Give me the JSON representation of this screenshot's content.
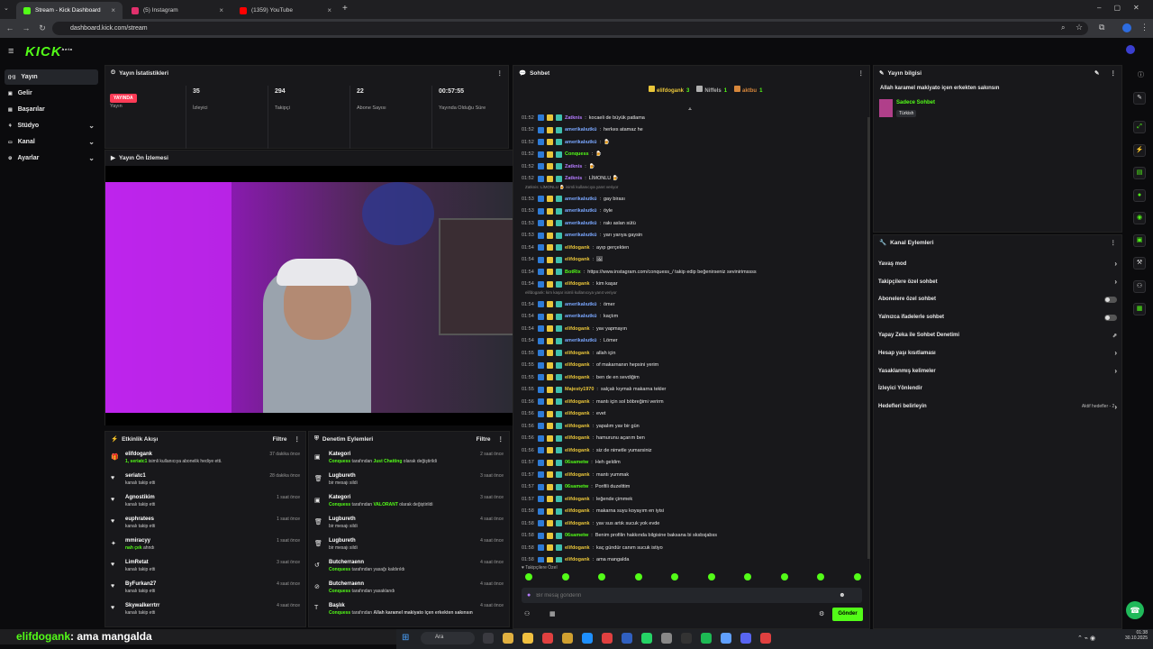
{
  "browser": {
    "tabs": [
      {
        "title": "Stream - Kick Dashboard",
        "active": true,
        "color": "#53fc18"
      },
      {
        "title": "(5) Instagram",
        "active": false,
        "color": "#e1306c"
      },
      {
        "title": "(1359) YouTube",
        "active": false,
        "color": "#ff0000"
      }
    ],
    "url": "dashboard.kick.com/stream",
    "close_glyph": "×",
    "new_tab_glyph": "+"
  },
  "app": {
    "logo": "KICK",
    "logo_suffix": "beta",
    "menu_icon": "hamburger-icon"
  },
  "sidebar": {
    "items": [
      {
        "label": "Yayın",
        "active": true,
        "chevron": false
      },
      {
        "label": "Gelir",
        "active": false,
        "chevron": false
      },
      {
        "label": "Başarılar",
        "active": false,
        "chevron": false
      },
      {
        "label": "Stüdyo",
        "active": false,
        "chevron": true
      },
      {
        "label": "Kanal",
        "active": false,
        "chevron": true
      },
      {
        "label": "Ayarlar",
        "active": false,
        "chevron": true
      }
    ]
  },
  "stats": {
    "title": "Yayın İstatistikleri",
    "live_badge": "YAYINDA",
    "live_label": "Yayın",
    "items": [
      {
        "value": "35",
        "label": "İzleyici"
      },
      {
        "value": "294",
        "label": "Takipçi"
      },
      {
        "value": "22",
        "label": "Abone Sayısı"
      },
      {
        "value": "00:57:55",
        "label": "Yayında Olduğu Süre"
      }
    ]
  },
  "preview": {
    "title": "Yayın Ön İzlemesi"
  },
  "activity": {
    "title": "Etkinlik Akışı",
    "filter": "Filtre",
    "rows": [
      {
        "name": "elifdogank",
        "detail_hl": "1, seriatc1",
        "detail": " isimli kullanıcıya abonelik hediye etti.",
        "time": "37 dakika önce",
        "icon": "gift-icon"
      },
      {
        "name": "seriatc1",
        "detail_hl": "",
        "detail": "kanalı takip etti",
        "time": "28 dakika önce",
        "icon": "heart-icon"
      },
      {
        "name": "Agnostikim",
        "detail_hl": "",
        "detail": "kanalı takip etti",
        "time": "1 saat önce",
        "icon": "heart-icon"
      },
      {
        "name": "euphratees",
        "detail_hl": "",
        "detail": "kanalı takip etti",
        "time": "1 saat önce",
        "icon": "heart-icon"
      },
      {
        "name": "mmiracyy",
        "detail_hl": "nah çek",
        "detail": " ahndı",
        "time": "1 saat önce",
        "icon": "reward-icon"
      },
      {
        "name": "LimRetat",
        "detail_hl": "",
        "detail": "kanalı takip etti",
        "time": "3 saat önce",
        "icon": "heart-icon"
      },
      {
        "name": "ByFurkan27",
        "detail_hl": "",
        "detail": "kanalı takip etti",
        "time": "4 saat önce",
        "icon": "heart-icon"
      },
      {
        "name": "Skywalkerrtrr",
        "detail_hl": "",
        "detail": "kanalı takip etti",
        "time": "4 saat önce",
        "icon": "heart-icon"
      }
    ]
  },
  "moderation": {
    "title": "Denetim Eylemleri",
    "filter": "Filtre",
    "rows": [
      {
        "name": "Kategori",
        "detail_hl": "Conquess",
        "detail": " tarafından ",
        "detail_hl2": "Just Chatting",
        "detail_end": " olarak değiştirildi",
        "time": "2 saat önce",
        "icon": "category-icon"
      },
      {
        "name": "Lugbureth",
        "detail_hl": "",
        "detail": "bir mesajı sildi",
        "detail_hl2": "",
        "detail_end": "",
        "time": "3 saat önce",
        "icon": "trash-icon"
      },
      {
        "name": "Kategori",
        "detail_hl": "Conquess",
        "detail": " tarafından ",
        "detail_hl2": "VALORANT",
        "detail_end": " olarak değiştirildi",
        "time": "3 saat önce",
        "icon": "category-icon"
      },
      {
        "name": "Lugbureth",
        "detail_hl": "",
        "detail": "bir mesajı sildi",
        "detail_hl2": "",
        "detail_end": "",
        "time": "4 saat önce",
        "icon": "trash-icon"
      },
      {
        "name": "Lugbureth",
        "detail_hl": "",
        "detail": "bir mesajı sildi",
        "detail_hl2": "",
        "detail_end": "",
        "time": "4 saat önce",
        "icon": "trash-icon"
      },
      {
        "name": "Butcherraenn",
        "detail_hl": "Conquess",
        "detail": " tarafından yasağı kaldırıldı",
        "detail_hl2": "",
        "detail_end": "",
        "time": "4 saat önce",
        "icon": "unban-icon"
      },
      {
        "name": "Butcherraenn",
        "detail_hl": "Conquess",
        "detail": " tarafından yasaklandı",
        "detail_hl2": "",
        "detail_end": "",
        "time": "4 saat önce",
        "icon": "ban-icon"
      },
      {
        "name": "Başlık",
        "detail_hl": "Conquess",
        "detail": " tarafından ",
        "detail_hl2": "",
        "detail_end": "Allah karamel makiyato içen erkekten sakınsın",
        "time": "4 saat önce",
        "icon": "title-icon"
      }
    ]
  },
  "chat": {
    "title": "Sohbet",
    "top_users": [
      {
        "name": "elifdogank",
        "count": "3"
      },
      {
        "name": "Niffels",
        "count": "1"
      },
      {
        "name": "aktbu",
        "count": "1"
      }
    ],
    "messages": [
      {
        "time": "01:52",
        "user": "Zatknis",
        "color": "#b57bff",
        "text": "kocaeli de büyük patlama"
      },
      {
        "time": "01:52",
        "user": "amerikalıutkü",
        "color": "#7aa7ff",
        "text": "herkes atamaz he"
      },
      {
        "time": "01:52",
        "user": "amerikalıutkü",
        "color": "#7aa7ff",
        "text": "🍺"
      },
      {
        "time": "01:52",
        "user": "Conquess",
        "color": "#53fc18",
        "text": "🍺"
      },
      {
        "time": "01:52",
        "user": "Zatknis",
        "color": "#b57bff",
        "text": "🍺"
      },
      {
        "time": "01:52",
        "user": "Zatknis",
        "color": "#b57bff",
        "text": "LİMONLU 🍺"
      },
      {
        "time": "01:53",
        "user": "amerikalıutkü",
        "color": "#7aa7ff",
        "text": "gay birası",
        "reply": "Zatknis: LİMONLU 🍺 isimli kullanıcıya yanıt veriyor"
      },
      {
        "time": "01:53",
        "user": "amerikalıutkü",
        "color": "#7aa7ff",
        "text": "öyle"
      },
      {
        "time": "01:53",
        "user": "amerikalıutkü",
        "color": "#7aa7ff",
        "text": "rakı aslan sütü"
      },
      {
        "time": "01:53",
        "user": "amerikalıutkü",
        "color": "#7aa7ff",
        "text": "yarı yarıya gaysin"
      },
      {
        "time": "01:54",
        "user": "elifdogank",
        "color": "#e9c53a",
        "text": "ayıp gerçekten"
      },
      {
        "time": "01:54",
        "user": "elifdogank",
        "color": "#e9c53a",
        "text": "🖼"
      },
      {
        "time": "01:54",
        "user": "BotRix",
        "color": "#53fc18",
        "text": "https://www.instagram.com/conquess_/ takip edip beğenirseniz sevinirimssss"
      },
      {
        "time": "01:54",
        "user": "elifdogank",
        "color": "#e9c53a",
        "text": "kim kaşar"
      },
      {
        "time": "01:54",
        "user": "amerikalıutkü",
        "color": "#7aa7ff",
        "text": "ömer",
        "reply": "elifdogank: kim kaşar isimli kullanıcıya yanıt veriyor"
      },
      {
        "time": "01:54",
        "user": "amerikalıutkü",
        "color": "#7aa7ff",
        "text": "kaçtım"
      },
      {
        "time": "01:54",
        "user": "elifdogank",
        "color": "#e9c53a",
        "text": "yav yapmayın"
      },
      {
        "time": "01:54",
        "user": "amerikalıutkü",
        "color": "#7aa7ff",
        "text": "Lömer"
      },
      {
        "time": "01:55",
        "user": "elifdogank",
        "color": "#e9c53a",
        "text": "allah için"
      },
      {
        "time": "01:55",
        "user": "elifdogank",
        "color": "#e9c53a",
        "text": "of makarnanın hepsini yerim"
      },
      {
        "time": "01:55",
        "user": "elifdogank",
        "color": "#e9c53a",
        "text": "ben de en sevdiğim"
      },
      {
        "time": "01:55",
        "user": "Majesty1970",
        "color": "#e9c53a",
        "text": "salçalı kıymalı makarna tekler"
      },
      {
        "time": "01:56",
        "user": "elifdogank",
        "color": "#e9c53a",
        "text": "mantı için sol böbreğimi verirm"
      },
      {
        "time": "01:56",
        "user": "elifdogank",
        "color": "#e9c53a",
        "text": "evet"
      },
      {
        "time": "01:56",
        "user": "elifdogank",
        "color": "#e9c53a",
        "text": "yapalım yav bir gün"
      },
      {
        "time": "01:56",
        "user": "elifdogank",
        "color": "#e9c53a",
        "text": "hamurunu açarım ben"
      },
      {
        "time": "01:56",
        "user": "elifdogank",
        "color": "#e9c53a",
        "text": "siz de nimetle yumarsiniz"
      },
      {
        "time": "01:57",
        "user": "06sametw",
        "color": "#53fc18",
        "text": "Heh geldim"
      },
      {
        "time": "01:57",
        "user": "elifdogank",
        "color": "#e9c53a",
        "text": "mantı yummak"
      },
      {
        "time": "01:57",
        "user": "06sametw",
        "color": "#53fc18",
        "text": "Porifili duzelttim"
      },
      {
        "time": "01:57",
        "user": "elifdogank",
        "color": "#e9c53a",
        "text": "leğende çimmek"
      },
      {
        "time": "01:58",
        "user": "elifdogank",
        "color": "#e9c53a",
        "text": "makarna suyu koyayım en iyisi"
      },
      {
        "time": "01:58",
        "user": "elifdogank",
        "color": "#e9c53a",
        "text": "yav sus artık sucuk yok evde"
      },
      {
        "time": "01:58",
        "user": "06sametw",
        "color": "#53fc18",
        "text": "Benim profilin hakkında bilgisine baksana bi sksbsjabss"
      },
      {
        "time": "01:58",
        "user": "elifdogank",
        "color": "#e9c53a",
        "text": "kaç gündür canım sucuk istiyo"
      },
      {
        "time": "01:58",
        "user": "elifdogank",
        "color": "#e9c53a",
        "text": "ama mangalda"
      }
    ],
    "followers_only": "Takipçilere Özel",
    "placeholder": "Bir mesaj gönderin",
    "send": "Gönder"
  },
  "stream_info": {
    "title": "Yayın bilgisi",
    "stream_title": "Allah karamel makiyato içen erkekten sakınsın",
    "category": "Sadece Sohbet",
    "language": "Türkish"
  },
  "channel_actions": {
    "title": "Kanal Eylemleri",
    "items": [
      {
        "label": "Yavaş mod",
        "control": "arrow"
      },
      {
        "label": "Takipçilere özel sohbet",
        "control": "arrow"
      },
      {
        "label": "Abonelere özel sohbet",
        "control": "toggle"
      },
      {
        "label": "Yalnızca ifadelerle sohbet",
        "control": "toggle"
      },
      {
        "label": "Yapay Zeka ile Sohbet Denetimi",
        "control": "external"
      },
      {
        "label": "Hesap yaşı kısıtlaması",
        "control": "arrow"
      },
      {
        "label": "Yasaklanmış kelimeler",
        "control": "arrow"
      },
      {
        "label": "İzleyici Yönlendir",
        "control": "none"
      },
      {
        "label": "Hedefleri belirleyin",
        "control": "goals",
        "extra": "Aktif hedefler - 2"
      }
    ]
  },
  "overlay_caption": {
    "user": "elifdogank",
    "text": ": ama mangalda"
  },
  "taskbar": {
    "search": "Ara",
    "time": "01:38",
    "date": "30.10.2025"
  }
}
